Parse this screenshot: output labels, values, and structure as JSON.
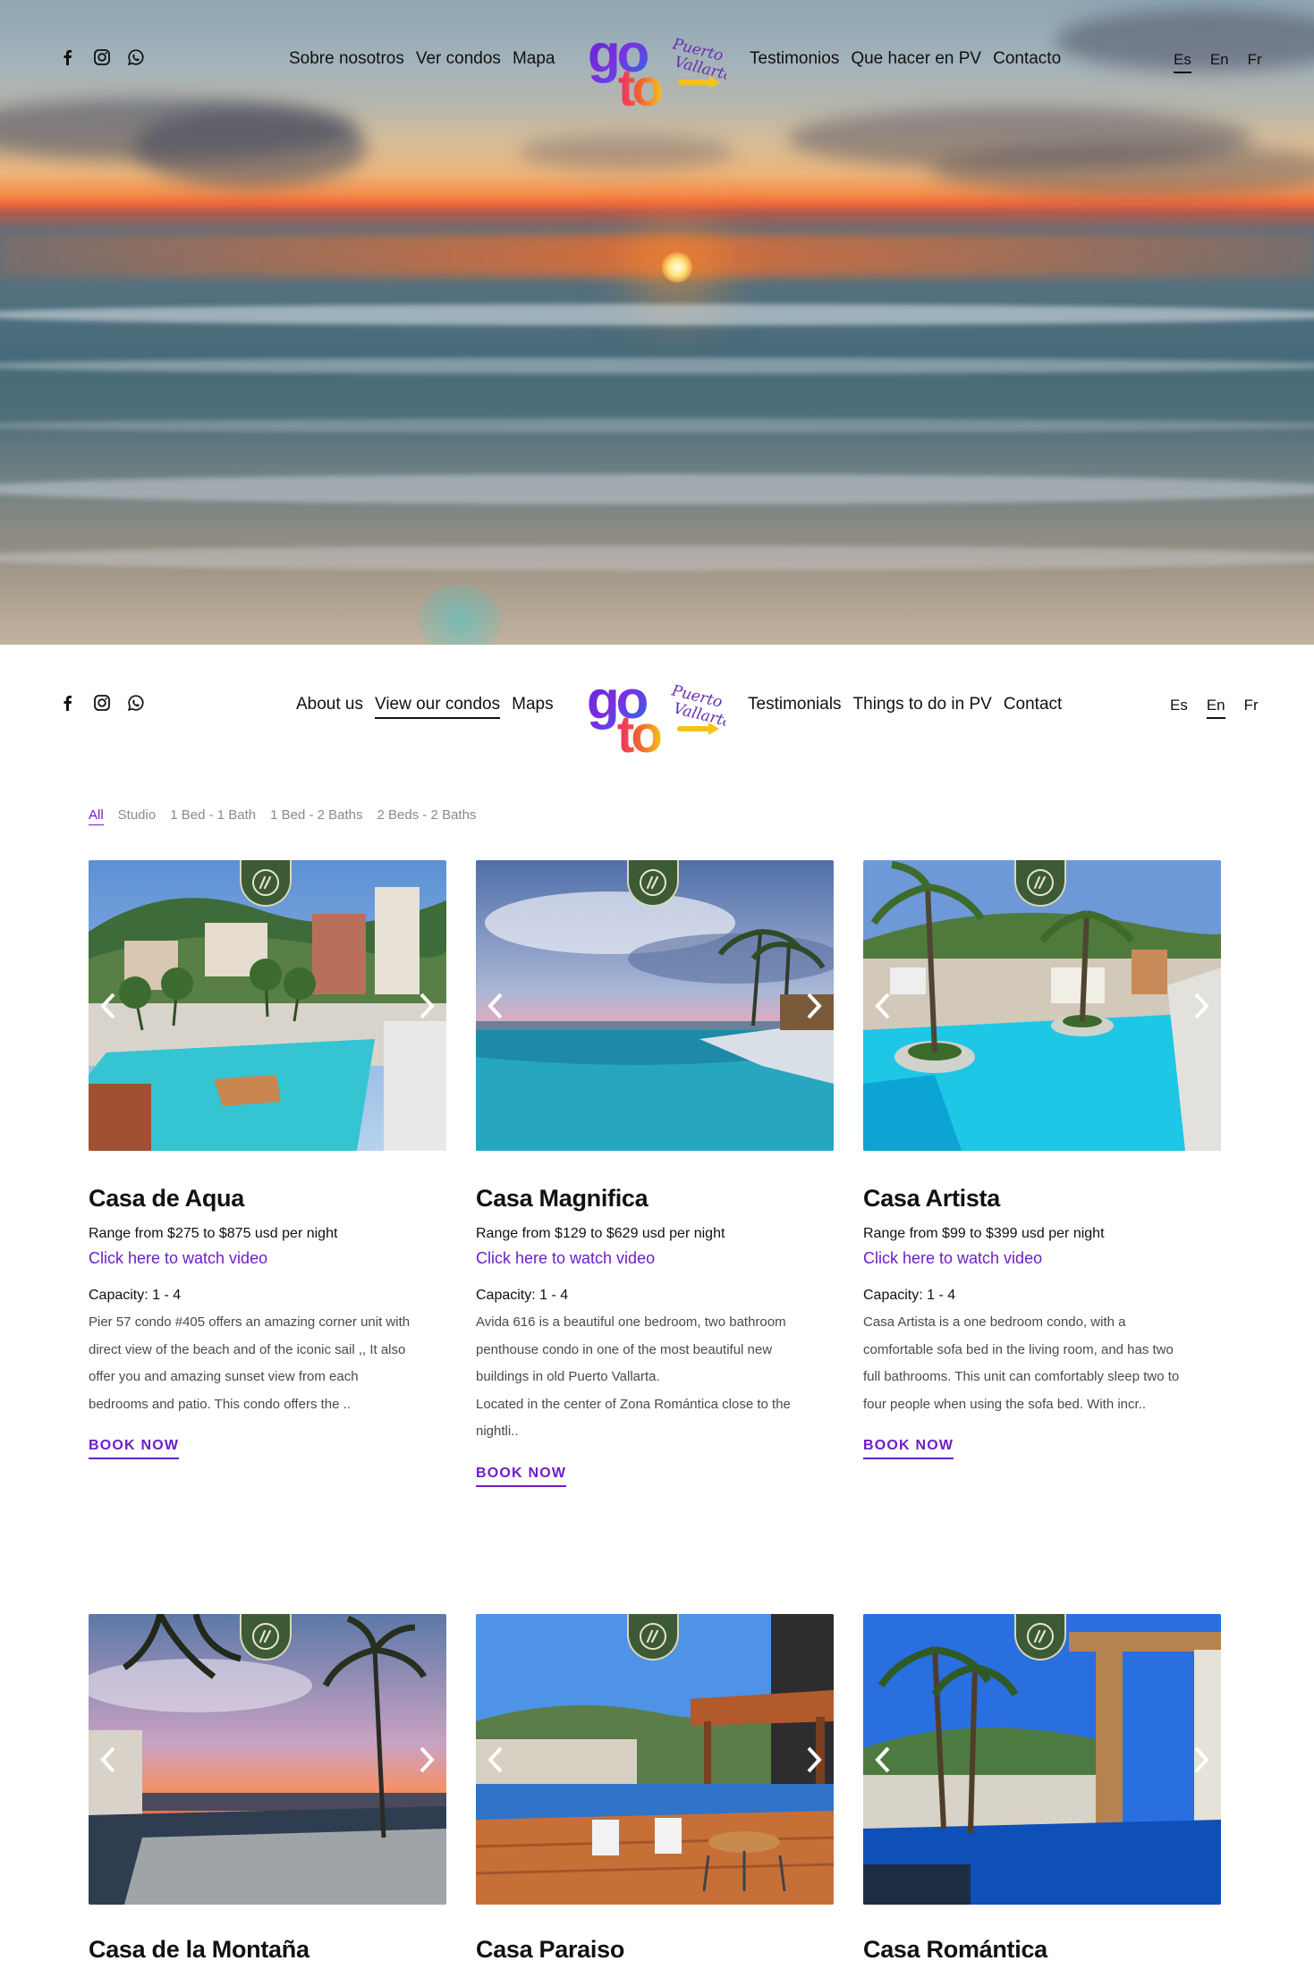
{
  "hero": {
    "header": {
      "social": [
        "facebook-icon",
        "instagram-icon",
        "whatsapp-icon"
      ],
      "nav_left": [
        "Sobre nosotros",
        "Ver condos",
        "Mapa"
      ],
      "nav_right": [
        "Testimonios",
        "Que hacer en PV",
        "Contacto"
      ],
      "languages": [
        "Es",
        "En",
        "Fr"
      ],
      "active_language": "Es"
    }
  },
  "logo": {
    "text_top": "go",
    "text_bottom": "to",
    "script": "Puerto Vallarta"
  },
  "header": {
    "social": [
      "facebook-icon",
      "instagram-icon",
      "whatsapp-icon"
    ],
    "nav_left": [
      "About us",
      "View our condos",
      "Maps"
    ],
    "nav_right": [
      "Testimonials",
      "Things to do in PV",
      "Contact"
    ],
    "languages": [
      "Es",
      "En",
      "Fr"
    ],
    "active_nav": "View our condos",
    "active_language": "En"
  },
  "filters": [
    "All",
    "Studio",
    "1 Bed - 1 Bath",
    "1 Bed - 2 Baths",
    "2 Beds - 2 Baths"
  ],
  "active_filter": "All",
  "colors": {
    "accent": "#6d1ec9",
    "badge": "#3d5a36"
  },
  "condos": [
    {
      "title": "Casa de Aqua",
      "range": "Range from $275 to $875 usd per night",
      "video": "Click here to watch video",
      "capacity": "Capacity: 1 - 4",
      "description": [
        "Pier 57 condo #405 offers an amazing corner unit with",
        "direct view of the beach and of the iconic sail ,, It also",
        "offer you and amazing sunset view from each",
        "bedrooms and patio. This condo offers the .."
      ],
      "cta": "BOOK NOW"
    },
    {
      "title": "Casa Magnifica",
      "range": "Range from $129 to $629 usd per night",
      "video": "Click here to watch video",
      "capacity": "Capacity: 1 - 4",
      "description": [
        "Avida 616 is a beautiful one bedroom, two bathroom",
        "penthouse condo in one of the most beautiful new",
        "buildings in old Puerto Vallarta.",
        "Located in the center of Zona Romántica close to the",
        "nightli.."
      ],
      "cta": "BOOK NOW"
    },
    {
      "title": "Casa Artista",
      "range": "Range from $99 to $399 usd per night",
      "video": "Click here to watch video",
      "capacity": "Capacity: 1 - 4",
      "description": [
        "Casa Artista is a one bedroom condo, with a",
        "comfortable sofa bed in the living room, and has two",
        "full bathrooms. This unit can comfortably sleep two to",
        "four people when using the sofa bed. With incr.."
      ],
      "cta": "BOOK NOW"
    },
    {
      "title": "Casa de la Montaña"
    },
    {
      "title": "Casa Paraiso"
    },
    {
      "title": "Casa Romántica"
    }
  ]
}
